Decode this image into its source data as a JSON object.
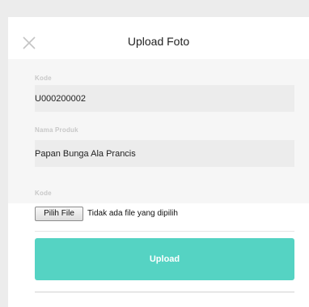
{
  "modal": {
    "title": "Upload Foto",
    "close_icon": "close-icon"
  },
  "fields": [
    {
      "label": "Kode",
      "value": "U000200002"
    },
    {
      "label": "Nama Produk",
      "value": "Papan Bunga Ala Prancis"
    }
  ],
  "file_upload": {
    "label": "Kode",
    "button_label": "Pilih File",
    "status_text": "Tidak ada file yang dipilih"
  },
  "upload_button": {
    "label": "Upload"
  },
  "colors": {
    "accent": "#55d3c3",
    "background": "#ececec",
    "input_background": "#ececec"
  }
}
